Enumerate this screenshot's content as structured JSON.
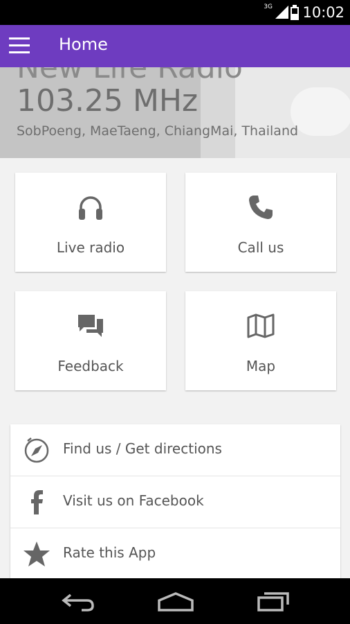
{
  "status_bar": {
    "network": "3G",
    "time": "10:02"
  },
  "app_bar": {
    "title": "Home"
  },
  "hero": {
    "station_name": "New Life Radio",
    "frequency": "103.25 MHz",
    "location": "SobPoeng, MaeTaeng, ChiangMai, Thailand"
  },
  "tiles": [
    {
      "label": "Live radio",
      "icon": "headphones-icon"
    },
    {
      "label": "Call us",
      "icon": "phone-icon"
    },
    {
      "label": "Feedback",
      "icon": "chat-bubbles-icon"
    },
    {
      "label": "Map",
      "icon": "folded-map-icon"
    }
  ],
  "links": [
    {
      "label": "Find us / Get directions",
      "icon": "compass-icon"
    },
    {
      "label": "Visit us on Facebook",
      "icon": "facebook-icon"
    },
    {
      "label": "Rate this App",
      "icon": "star-icon"
    }
  ],
  "colors": {
    "accent": "#6e3cc0",
    "icon": "#666666"
  }
}
